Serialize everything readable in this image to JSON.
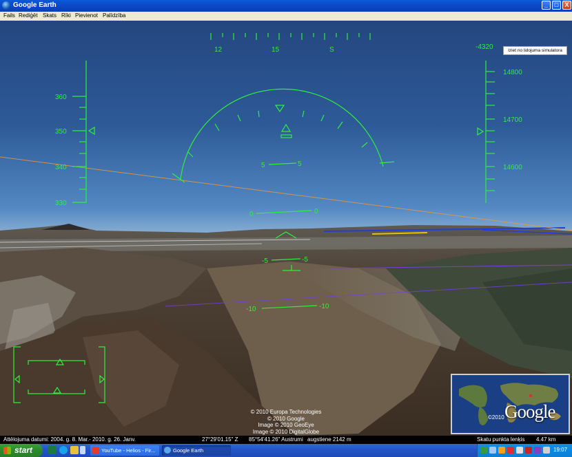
{
  "window": {
    "title": "Google Earth",
    "buttons": {
      "minimize": "_",
      "maximize": "□",
      "close": "X"
    }
  },
  "menu": [
    "Fails",
    "Rediģēt",
    "Skats",
    "Rīki",
    "Pievienot",
    "Palīdzība"
  ],
  "exit_sim_button": "Iziet no lidojuma simulatora",
  "hud": {
    "color": "#2ef03d",
    "heading_labels": [
      "12",
      "15",
      "S"
    ],
    "vertical_speed": "-4320",
    "speed_labels": [
      "360",
      "350",
      "340",
      "330"
    ],
    "altitude_labels": [
      "14800",
      "14700",
      "14600"
    ],
    "pitch_ladder": [
      {
        "left": "5",
        "right": "5"
      },
      {
        "left": "0",
        "right": "0"
      },
      {
        "left": "-5",
        "right": "-5"
      },
      {
        "left": "-10",
        "right": "-10"
      }
    ]
  },
  "copyright": [
    "© 2010 Europa Technologies",
    "© 2010 Google",
    "Image © 2010 GeoEye",
    "Image © 2010 DigitalGlobe"
  ],
  "minimap": {
    "brand": "Google",
    "copyright": "©2010"
  },
  "status": {
    "imagery_date": "Attēlojuma datumi: 2004. g.  8. Mar.- 2010. g. 26. Janv.",
    "latitude": "27°29'01.15\" Z",
    "longitude": "85°54'41.26\" Austrumi",
    "elevation": "augstiene 2142 m",
    "eye_alt_label": "Skatu punkta lenķis",
    "eye_alt_value": "4.47 km"
  },
  "taskbar": {
    "start_label": "start",
    "tasks": [
      {
        "label": "YouTube - Helios - Fir...",
        "active": false
      },
      {
        "label": "Google Earth",
        "active": true
      }
    ],
    "clock": "19:07"
  }
}
